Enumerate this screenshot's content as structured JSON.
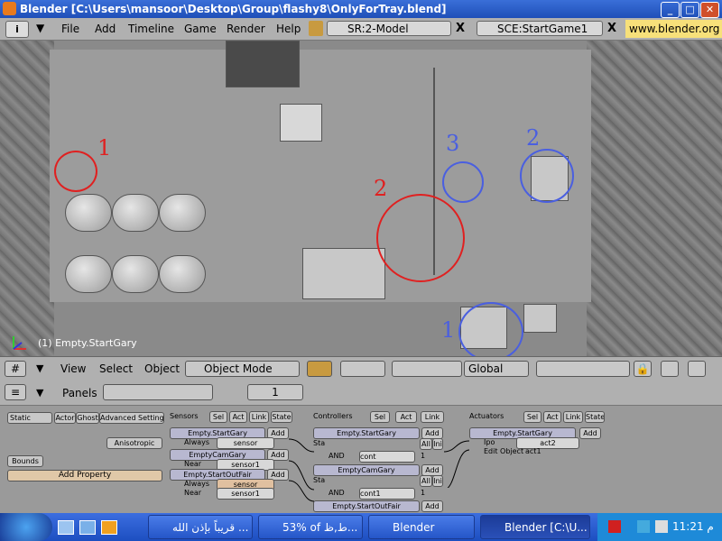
{
  "window": {
    "title": "Blender [C:\\Users\\mansoor\\Desktop\\Group\\flashy8\\OnlyForTray.blend]",
    "min": "_",
    "max": "□",
    "close": "✕"
  },
  "header": {
    "info_icon": "i",
    "menus": [
      "File",
      "Add",
      "Timeline",
      "Game",
      "Render",
      "Help"
    ],
    "screen_field": "SR:2-Model",
    "scene_field": "SCE:StartGame1",
    "close_x": "X",
    "url": "www.blender.org"
  },
  "viewport": {
    "status": "(1) Empty.StartGary",
    "labels": {
      "red1": "1",
      "red2": "2",
      "blue3": "3",
      "blue2": "2",
      "blue1": "1"
    }
  },
  "toolbar3d": {
    "view": "View",
    "select": "Select",
    "object": "Object",
    "mode": "Object Mode",
    "transform": "Global"
  },
  "buttons": {
    "panels": "Panels",
    "frame": "1",
    "left": {
      "static": "Static",
      "actor": "Actor",
      "ghost": "Ghost",
      "advanced": "Advanced Settings",
      "anisotropic": "Anisotropic",
      "bounds": "Bounds",
      "add_property": "Add Property"
    },
    "sensors": {
      "title": "Sensors",
      "tabs": [
        "Sel",
        "Act",
        "Link",
        "State"
      ],
      "blocks": [
        {
          "name": "Empty.StartGary",
          "add": "Add",
          "type": "Always",
          "sub": "sensor"
        },
        {
          "name": "EmptyCamGary",
          "add": "Add",
          "type": "Near",
          "sub": "sensor1"
        },
        {
          "name": "Empty.StartOutFair",
          "add": "Add",
          "type": "Always",
          "sub": "sensor",
          "type2": "Near",
          "sub2": "sensor1"
        }
      ]
    },
    "controllers": {
      "title": "Controllers",
      "tabs": [
        "Sel",
        "Act",
        "Link"
      ],
      "blocks": [
        {
          "name": "Empty.StartGary",
          "add": "Add",
          "sta": "Sta",
          "all": "All",
          "ini": "Ini",
          "type": "AND",
          "sub": "cont",
          "num": "1"
        },
        {
          "name": "EmptyCamGary",
          "add": "Add",
          "sta": "Sta",
          "all": "All",
          "ini": "Ini",
          "type": "AND",
          "sub": "cont1",
          "num": "1"
        },
        {
          "name": "Empty.StartOutFair",
          "add": "Add"
        }
      ]
    },
    "actuators": {
      "title": "Actuators",
      "tabs": [
        "Sel",
        "Act",
        "Link",
        "State"
      ],
      "blocks": [
        {
          "name": "Empty.StartGary",
          "add": "Add",
          "type": "Ipo",
          "sub": "act2",
          "type2": "Edit Object",
          "sub2": "act1"
        }
      ]
    }
  },
  "taskbar": {
    "tasks": [
      "قريباً بإذن الله ...",
      "53% of ط,ظ...",
      "Blender",
      "Blender [C:\\U..."
    ],
    "clock": "11:21 م"
  },
  "colors": {
    "accent": "#e02020",
    "blue_marker": "#4a5fe0",
    "titlebar": "#1f4fb8"
  }
}
